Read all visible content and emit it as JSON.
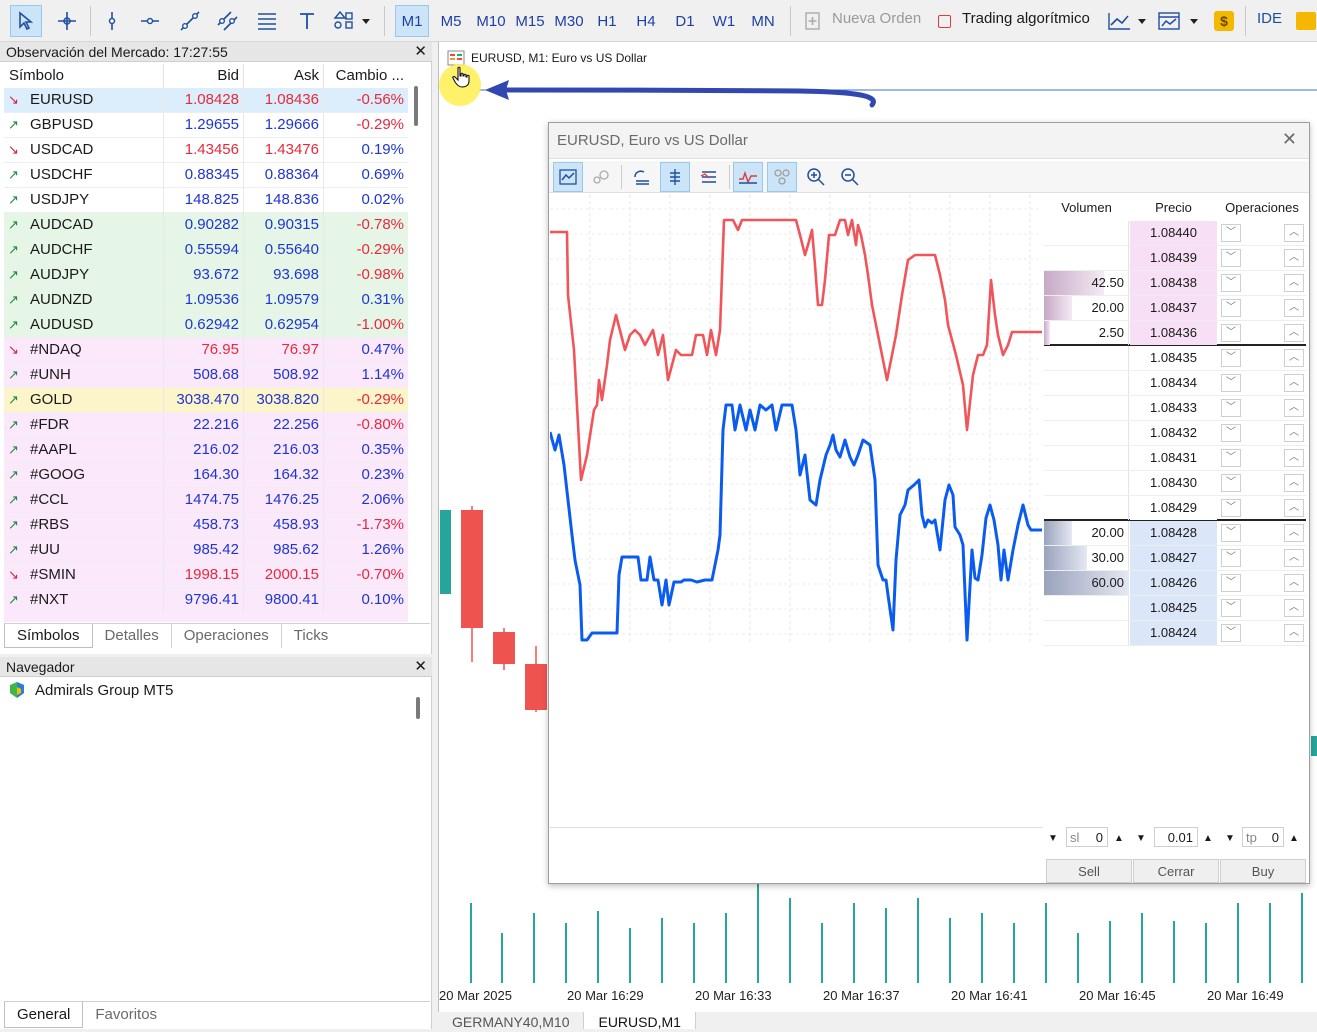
{
  "toolbar": {
    "timeframes": [
      "M1",
      "M5",
      "M10",
      "M15",
      "M30",
      "H1",
      "H4",
      "D1",
      "W1",
      "MN"
    ],
    "active_timeframe": "M1",
    "new_order_label": "Nueva Orden",
    "algo_trading_label": "Trading algorítmico",
    "ide_label": "IDE"
  },
  "market_watch": {
    "title": "Observación del Mercado: 17:27:55",
    "columns": [
      "Símbolo",
      "Bid",
      "Ask",
      "Cambio ..."
    ],
    "rows": [
      {
        "symbol": "EURUSD",
        "bid": "1.08428",
        "ask": "1.08436",
        "change": "-0.56%",
        "dir": "down"
      },
      {
        "symbol": "GBPUSD",
        "bid": "1.29655",
        "ask": "1.29666",
        "change": "-0.29%",
        "dir": "up"
      },
      {
        "symbol": "USDCAD",
        "bid": "1.43456",
        "ask": "1.43476",
        "change": "0.19%",
        "dir": "down"
      },
      {
        "symbol": "USDCHF",
        "bid": "0.88345",
        "ask": "0.88364",
        "change": "0.69%",
        "dir": "up"
      },
      {
        "symbol": "USDJPY",
        "bid": "148.825",
        "ask": "148.836",
        "change": "0.02%",
        "dir": "up"
      },
      {
        "symbol": "AUDCAD",
        "bid": "0.90282",
        "ask": "0.90315",
        "change": "-0.78%",
        "dir": "up"
      },
      {
        "symbol": "AUDCHF",
        "bid": "0.55594",
        "ask": "0.55640",
        "change": "-0.29%",
        "dir": "up"
      },
      {
        "symbol": "AUDJPY",
        "bid": "93.672",
        "ask": "93.698",
        "change": "-0.98%",
        "dir": "up"
      },
      {
        "symbol": "AUDNZD",
        "bid": "1.09536",
        "ask": "1.09579",
        "change": "0.31%",
        "dir": "up"
      },
      {
        "symbol": "AUDUSD",
        "bid": "0.62942",
        "ask": "0.62954",
        "change": "-1.00%",
        "dir": "up"
      },
      {
        "symbol": "#NDAQ",
        "bid": "76.95",
        "ask": "76.97",
        "change": "0.47%",
        "dir": "down"
      },
      {
        "symbol": "#UNH",
        "bid": "508.68",
        "ask": "508.92",
        "change": "1.14%",
        "dir": "up"
      },
      {
        "symbol": "GOLD",
        "bid": "3038.470",
        "ask": "3038.820",
        "change": "-0.29%",
        "dir": "up"
      },
      {
        "symbol": "#FDR",
        "bid": "22.216",
        "ask": "22.256",
        "change": "-0.80%",
        "dir": "up"
      },
      {
        "symbol": "#AAPL",
        "bid": "216.02",
        "ask": "216.03",
        "change": "0.35%",
        "dir": "up"
      },
      {
        "symbol": "#GOOG",
        "bid": "164.30",
        "ask": "164.32",
        "change": "0.23%",
        "dir": "up"
      },
      {
        "symbol": "#CCL",
        "bid": "1474.75",
        "ask": "1476.25",
        "change": "2.06%",
        "dir": "up"
      },
      {
        "symbol": "#RBS",
        "bid": "458.73",
        "ask": "458.93",
        "change": "-1.73%",
        "dir": "up"
      },
      {
        "symbol": "#UU",
        "bid": "985.42",
        "ask": "985.62",
        "change": "1.26%",
        "dir": "up"
      },
      {
        "symbol": "#SMIN",
        "bid": "1998.15",
        "ask": "2000.15",
        "change": "-0.70%",
        "dir": "down"
      },
      {
        "symbol": "#NXT",
        "bid": "9796.41",
        "ask": "9800.41",
        "change": "0.10%",
        "dir": "up"
      }
    ],
    "tabs": [
      "Símbolos",
      "Detalles",
      "Operaciones",
      "Ticks"
    ]
  },
  "navigator": {
    "title": "Navegador",
    "root_item": "Admirals Group MT5",
    "tabs": [
      "General",
      "Favoritos"
    ]
  },
  "chart": {
    "title": "EURUSD, M1:  Euro vs US Dollar",
    "date_labels": [
      "20 Mar 2025",
      "20 Mar 16:29",
      "20 Mar 16:33",
      "20 Mar 16:37",
      "20 Mar 16:41",
      "20 Mar 16:45",
      "20 Mar 16:49"
    ],
    "tabs": [
      "GERMANY40,M10",
      "EURUSD,M1"
    ]
  },
  "depth_window": {
    "title": "EURUSD, Euro vs US Dollar",
    "columns": [
      "Volumen",
      "Precio",
      "Operaciones"
    ],
    "levels": [
      {
        "volume": "",
        "price": "1.08440",
        "side": "ask"
      },
      {
        "volume": "",
        "price": "1.08439",
        "side": "ask"
      },
      {
        "volume": "42.50",
        "price": "1.08438",
        "side": "ask"
      },
      {
        "volume": "20.00",
        "price": "1.08437",
        "side": "ask"
      },
      {
        "volume": "2.50",
        "price": "1.08436",
        "side": "ask"
      },
      {
        "volume": "",
        "price": "1.08435",
        "side": "mid"
      },
      {
        "volume": "",
        "price": "1.08434",
        "side": "mid"
      },
      {
        "volume": "",
        "price": "1.08433",
        "side": "mid"
      },
      {
        "volume": "",
        "price": "1.08432",
        "side": "mid"
      },
      {
        "volume": "",
        "price": "1.08431",
        "side": "mid"
      },
      {
        "volume": "",
        "price": "1.08430",
        "side": "mid"
      },
      {
        "volume": "",
        "price": "1.08429",
        "side": "mid"
      },
      {
        "volume": "20.00",
        "price": "1.08428",
        "side": "bid"
      },
      {
        "volume": "30.00",
        "price": "1.08427",
        "side": "bid"
      },
      {
        "volume": "60.00",
        "price": "1.08426",
        "side": "bid"
      },
      {
        "volume": "",
        "price": "1.08425",
        "side": "bid"
      },
      {
        "volume": "",
        "price": "1.08424",
        "side": "bid"
      }
    ],
    "sl_label": "sl",
    "sl_value": "0",
    "volume_value": "0.01",
    "tp_label": "tp",
    "tp_value": "0",
    "sell_label": "Sell",
    "close_label": "Cerrar",
    "buy_label": "Buy"
  },
  "colors": {
    "bid_red": "#e8283c",
    "ask_blue": "#1e35d6",
    "ask_line": "#f0555a",
    "bid_line": "#0a5cf0",
    "bull_candle": "#26a69a",
    "bear_candle": "#ef5350",
    "ask_bg": "#f7e0f5",
    "bid_bg": "#dbe6f8",
    "arrow": "#3347b0"
  }
}
